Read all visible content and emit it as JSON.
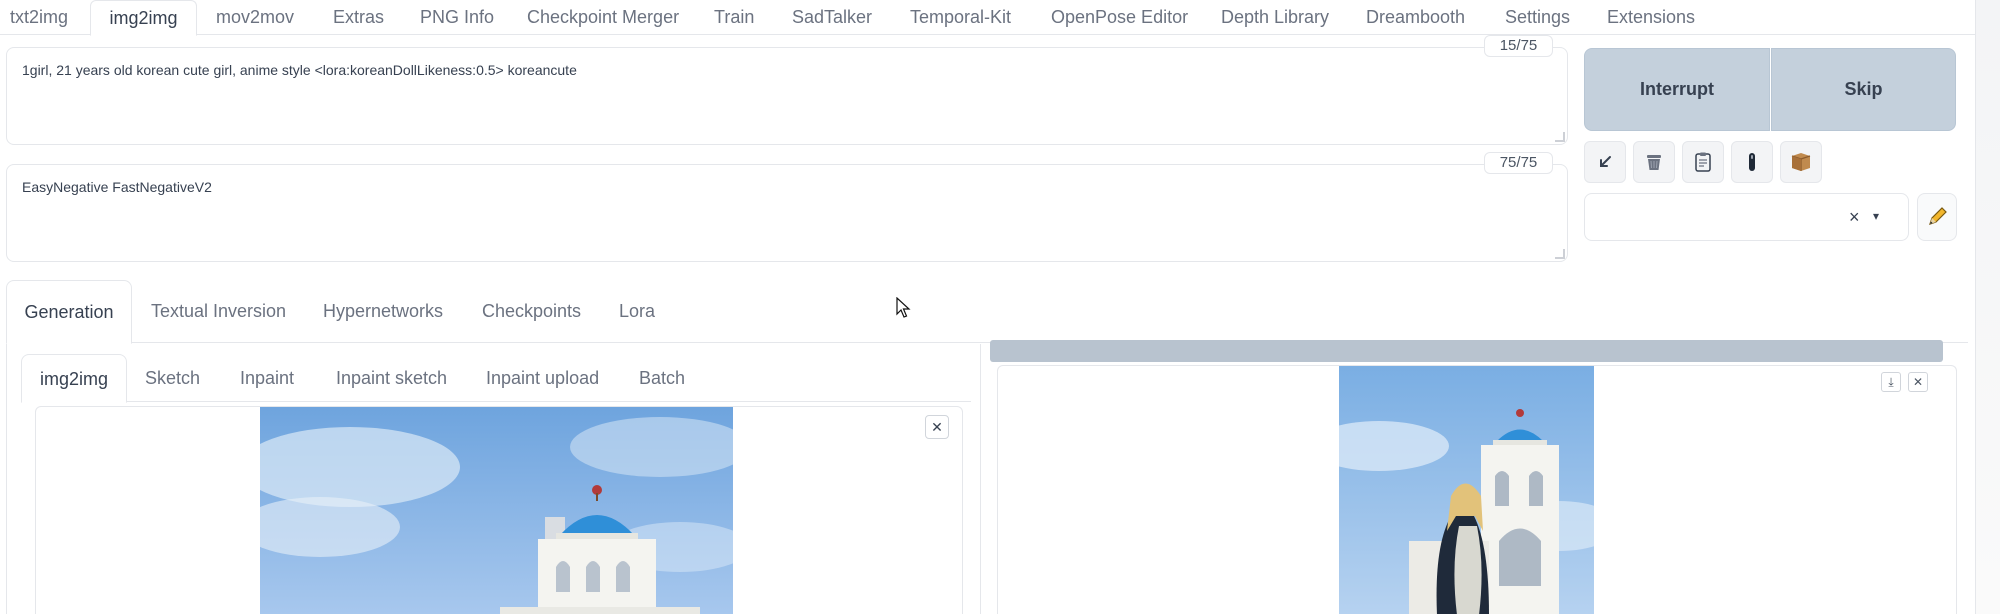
{
  "top_tabs": [
    {
      "label": "txt2img",
      "active": false
    },
    {
      "label": "img2img",
      "active": true
    },
    {
      "label": "mov2mov",
      "active": false
    },
    {
      "label": "Extras",
      "active": false
    },
    {
      "label": "PNG Info",
      "active": false
    },
    {
      "label": "Checkpoint Merger",
      "active": false
    },
    {
      "label": "Train",
      "active": false
    },
    {
      "label": "SadTalker",
      "active": false
    },
    {
      "label": "Temporal-Kit",
      "active": false
    },
    {
      "label": "OpenPose Editor",
      "active": false
    },
    {
      "label": "Depth Library",
      "active": false
    },
    {
      "label": "Dreambooth",
      "active": false
    },
    {
      "label": "Settings",
      "active": false
    },
    {
      "label": "Extensions",
      "active": false
    }
  ],
  "prompt": {
    "value": "1girl, 21 years old korean cute girl, anime style <lora:koreanDollLikeness:0.5> koreancute",
    "token_count": "15/75"
  },
  "negative_prompt": {
    "value": "EasyNegative FastNegativeV2",
    "token_count": "75/75"
  },
  "buttons": {
    "interrupt": "Interrupt",
    "skip": "Skip"
  },
  "tool_icons": [
    "arrow-read-icon",
    "trash-icon",
    "clipboard-icon",
    "extra-networks-icon",
    "save-style-icon"
  ],
  "styles_select": {
    "value": "",
    "clear_symbol": "×",
    "caret_symbol": "▾"
  },
  "sub_tabs": [
    {
      "label": "Generation",
      "active": true
    },
    {
      "label": "Textual Inversion",
      "active": false
    },
    {
      "label": "Hypernetworks",
      "active": false
    },
    {
      "label": "Checkpoints",
      "active": false
    },
    {
      "label": "Lora",
      "active": false
    }
  ],
  "img_tabs": [
    {
      "label": "img2img",
      "active": true
    },
    {
      "label": "Sketch",
      "active": false
    },
    {
      "label": "Inpaint",
      "active": false
    },
    {
      "label": "Inpaint sketch",
      "active": false
    },
    {
      "label": "Inpaint upload",
      "active": false
    },
    {
      "label": "Batch",
      "active": false
    }
  ],
  "colors": {
    "sky": "#7fb0e3",
    "dome": "#2f8fd8",
    "bell_tower": "#f2f2ee",
    "accent_button": "#c4d0dc",
    "progress_bar": "#b8c3cf"
  }
}
